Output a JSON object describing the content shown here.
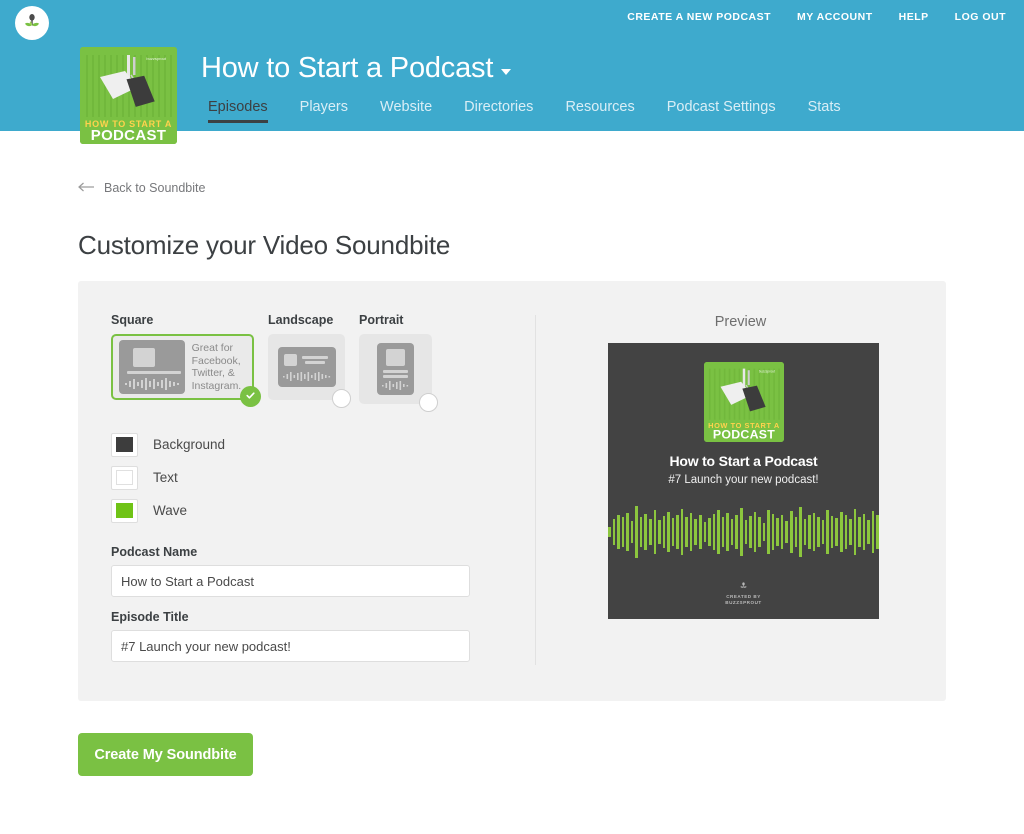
{
  "colors": {
    "brand_blue": "#3eaacd",
    "brand_green": "#7ac143",
    "wave_green": "#8cc63e",
    "preview_background": "#434343",
    "preview_text": "#ffffff",
    "panel_background": "#f2f2f2",
    "page_background": "#ffffff"
  },
  "topbar": {
    "logo_icon": "sprout-icon",
    "util_links": [
      {
        "label": "CREATE A NEW PODCAST",
        "name": "create-a-new-podcast"
      },
      {
        "label": "MY ACCOUNT",
        "name": "my-account"
      },
      {
        "label": "HELP",
        "name": "help"
      },
      {
        "label": "LOG OUT",
        "name": "log-out"
      }
    ],
    "podcast_title": "How to Start a Podcast",
    "dropdown_icon": "chevron-down-icon",
    "cover_art_alt": "How to Start a Podcast cover art",
    "cover_art_text_line1": "HOW TO START A",
    "cover_art_text_line2": "PODCAST",
    "cover_art_brand": "buzzsprout",
    "tabs": [
      {
        "label": "Episodes",
        "active": true
      },
      {
        "label": "Players",
        "active": false
      },
      {
        "label": "Website",
        "active": false
      },
      {
        "label": "Directories",
        "active": false
      },
      {
        "label": "Resources",
        "active": false
      },
      {
        "label": "Podcast Settings",
        "active": false
      },
      {
        "label": "Stats",
        "active": false
      }
    ]
  },
  "page": {
    "back_link": "Back to Soundbite",
    "back_icon": "arrow-left-icon",
    "title": "Customize your Video Soundbite"
  },
  "formats": [
    {
      "label": "Square",
      "selected": true,
      "hint": "Great for Facebook, Twitter, & Instagram.",
      "check_icon": "check-icon"
    },
    {
      "label": "Landscape",
      "selected": false,
      "hint": ""
    },
    {
      "label": "Portrait",
      "selected": false,
      "hint": ""
    }
  ],
  "swatches": [
    {
      "label": "Background",
      "color": "#3d3d3d"
    },
    {
      "label": "Text",
      "color": "#ffffff"
    },
    {
      "label": "Wave",
      "color": "#6fc316"
    }
  ],
  "fields": {
    "podcast_name_label": "Podcast Name",
    "podcast_name_value": "How to Start a Podcast",
    "podcast_name_placeholder": "Podcast Name",
    "episode_title_label": "Episode Title",
    "episode_title_value": "#7 Launch your new podcast!",
    "episode_title_placeholder": "Episode Title"
  },
  "preview": {
    "heading": "Preview",
    "title": "How to Start a Podcast",
    "subtitle": "#7 Launch your new podcast!",
    "footer_line1": "CREATED BY",
    "footer_line2": "BUZZSPROUT",
    "footer_icon": "sprout-icon",
    "wave_heights": [
      10,
      26,
      34,
      30,
      38,
      22,
      52,
      30,
      36,
      26,
      44,
      24,
      32,
      40,
      28,
      34,
      46,
      30,
      38,
      26,
      34,
      20,
      28,
      36,
      44,
      30,
      38,
      26,
      34,
      48,
      24,
      32,
      40,
      30,
      18,
      44,
      36,
      28,
      34,
      22,
      42,
      30,
      50,
      26,
      34,
      38,
      30,
      24,
      44,
      32,
      28,
      40,
      34,
      26,
      46,
      30,
      36,
      24,
      42,
      34
    ]
  },
  "submit": {
    "label": "Create My Soundbite"
  }
}
